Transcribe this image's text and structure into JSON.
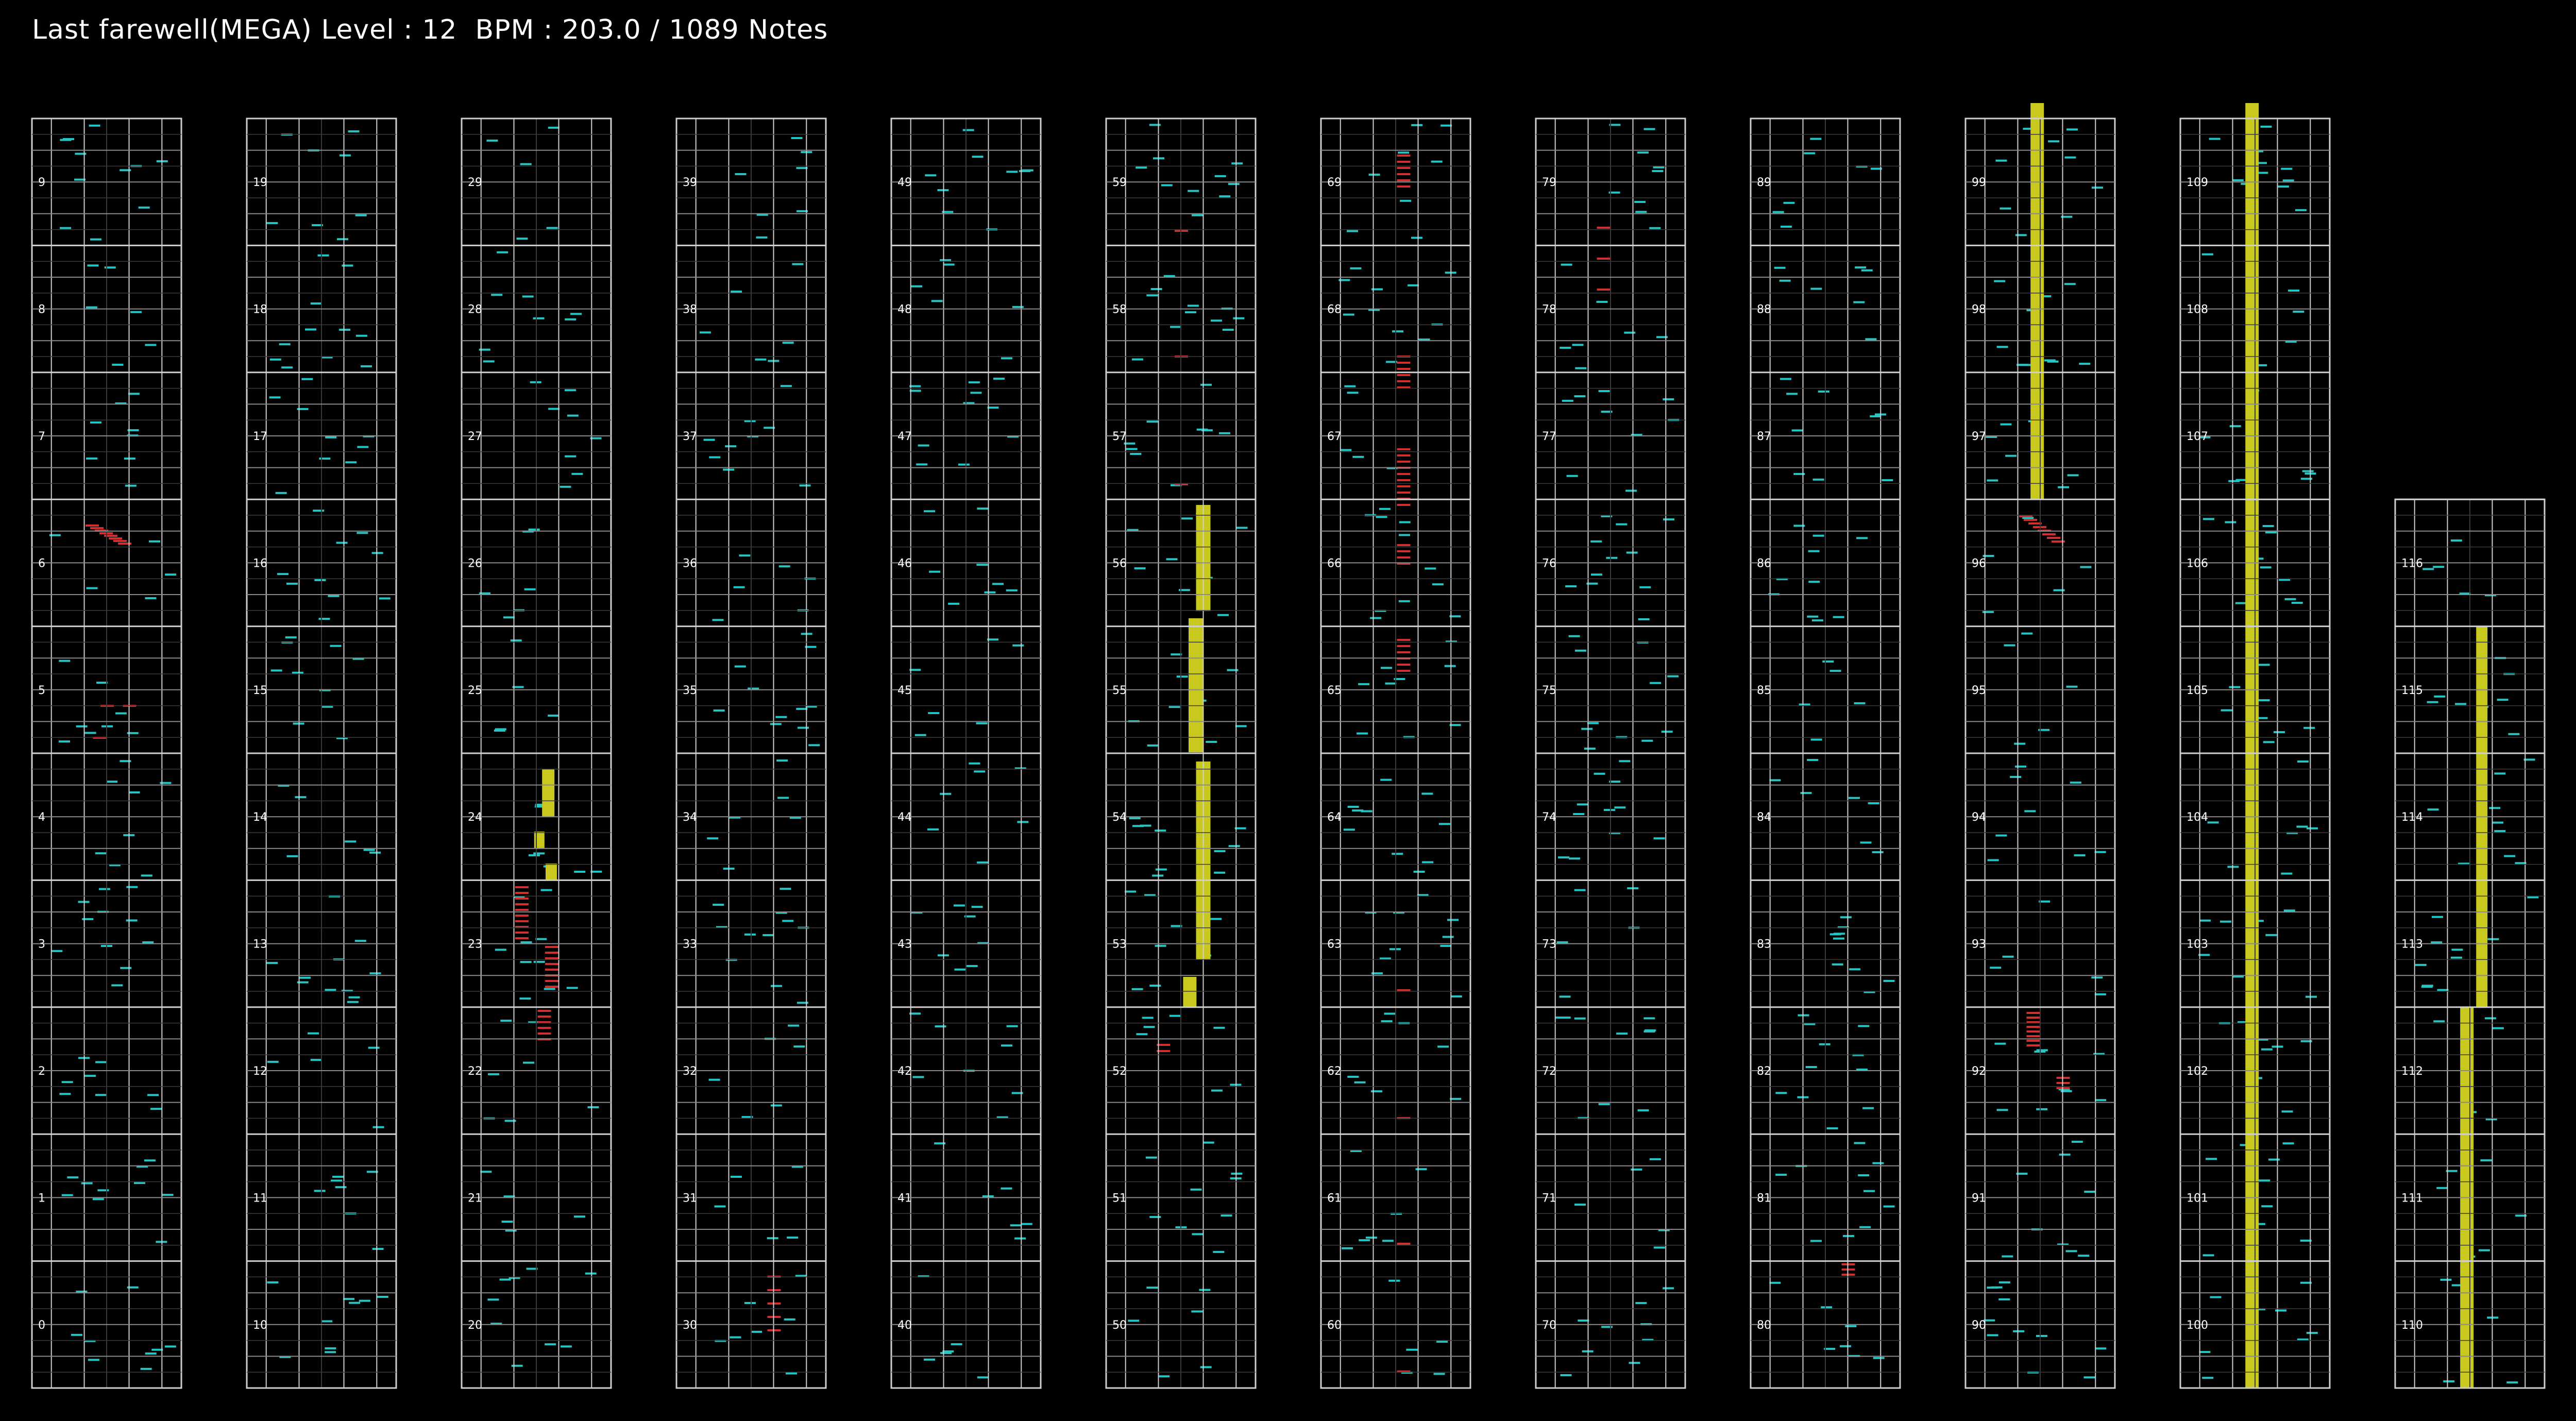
{
  "title": "Last farewell(MEGA) Level : 12  BPM : 203.0 / 1089 Notes",
  "colors": {
    "background": "#000000",
    "frame": "#cfcfcf",
    "beat_line": "#8a8a8a",
    "sub_line": "#3a3a3a",
    "tap_note": "#27c4c4",
    "flick_note": "#d03030",
    "hold_note": "#c8c81e"
  },
  "measure_columns": [
    {
      "measures": [
        "0",
        "1",
        "2",
        "3",
        "4",
        "5",
        "6",
        "7",
        "8",
        "9"
      ]
    },
    {
      "measures": [
        "10",
        "11",
        "12",
        "13",
        "14",
        "15",
        "16",
        "17",
        "18",
        "19"
      ]
    },
    {
      "measures": [
        "20",
        "21",
        "22",
        "23",
        "24",
        "25",
        "26",
        "27",
        "28",
        "29"
      ]
    },
    {
      "measures": [
        "30",
        "31",
        "32",
        "33",
        "34",
        "35",
        "36",
        "37",
        "38",
        "39"
      ]
    },
    {
      "measures": [
        "40",
        "41",
        "42",
        "43",
        "44",
        "45",
        "46",
        "47",
        "48",
        "49"
      ]
    },
    {
      "measures": [
        "50",
        "51",
        "52",
        "53",
        "54",
        "55",
        "56",
        "57",
        "58",
        "59"
      ]
    },
    {
      "measures": [
        "60",
        "61",
        "62",
        "63",
        "64",
        "65",
        "66",
        "67",
        "68",
        "69"
      ]
    },
    {
      "measures": [
        "70",
        "71",
        "72",
        "73",
        "74",
        "75",
        "76",
        "77",
        "78",
        "79"
      ]
    },
    {
      "measures": [
        "80",
        "81",
        "82",
        "83",
        "84",
        "85",
        "86",
        "87",
        "88",
        "89"
      ]
    },
    {
      "measures": [
        "90",
        "91",
        "92",
        "93",
        "94",
        "95",
        "96",
        "97",
        "98",
        "99"
      ]
    },
    {
      "measures": [
        "100",
        "101",
        "102",
        "103",
        "104",
        "105",
        "106",
        "107",
        "108",
        "109"
      ]
    },
    {
      "measures": [
        "110",
        "111",
        "112",
        "113",
        "114",
        "115",
        "116"
      ]
    }
  ]
}
